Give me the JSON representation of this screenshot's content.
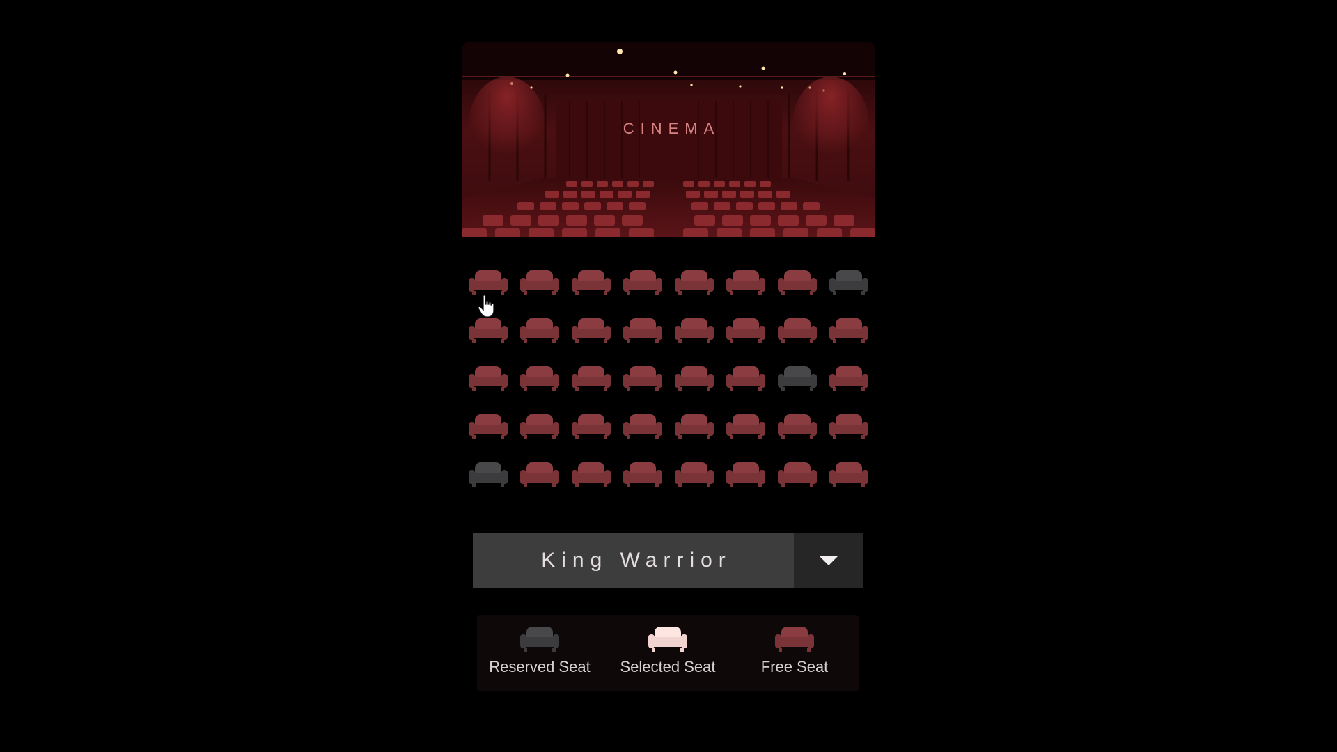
{
  "hero": {
    "sign_text": "CINEMA"
  },
  "colors": {
    "free": "#7a3438",
    "free_top": "#8a3c40",
    "reserved": "#3c3c3e",
    "reserved_top": "#48484a",
    "selected": "#f1d3cf",
    "selected_top": "#fde6e2"
  },
  "seats": {
    "rows": [
      [
        "free",
        "free",
        "free",
        "free",
        "free",
        "free",
        "free",
        "reserved"
      ],
      [
        "free",
        "free",
        "free",
        "free",
        "free",
        "free",
        "free",
        "free"
      ],
      [
        "free",
        "free",
        "free",
        "free",
        "free",
        "free",
        "reserved",
        "free"
      ],
      [
        "free",
        "free",
        "free",
        "free",
        "free",
        "free",
        "free",
        "free"
      ],
      [
        "reserved",
        "free",
        "free",
        "free",
        "free",
        "free",
        "free",
        "free"
      ]
    ]
  },
  "movie_select": {
    "selected": "King Warrior",
    "toggle_icon": "caret-down-icon"
  },
  "legend": {
    "items": [
      {
        "label": "Reserved Seat",
        "status": "reserved"
      },
      {
        "label": "Selected Seat",
        "status": "selected"
      },
      {
        "label": "Free Seat",
        "status": "free"
      }
    ]
  }
}
